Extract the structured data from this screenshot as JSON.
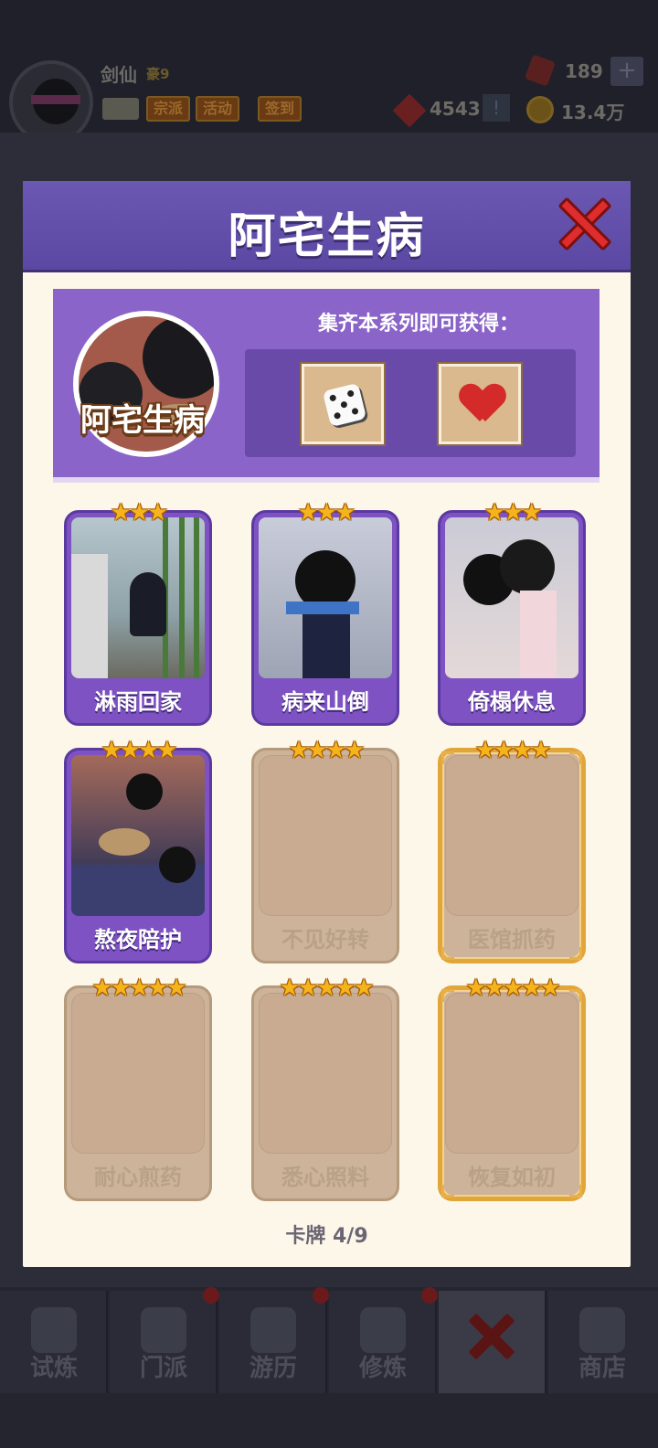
{
  "player": {
    "name": "剑仙",
    "rank": "豪9",
    "gems": "189",
    "tickets": "4543",
    "coins": "13.4万",
    "tags": [
      "宗派",
      "活动",
      "签到"
    ]
  },
  "modal": {
    "title": "阿宅生病",
    "series_name": "阿宅生病",
    "reward_title": "集齐本系列即可获得：",
    "rewards": [
      "dice-icon",
      "heart-icon"
    ],
    "progress_label": "卡牌 4/9",
    "cards": [
      {
        "label": "淋雨回家",
        "stars": "★★★",
        "owned": true
      },
      {
        "label": "病来山倒",
        "stars": "★★★",
        "owned": true
      },
      {
        "label": "倚榻休息",
        "stars": "★★★",
        "owned": true
      },
      {
        "label": "熬夜陪护",
        "stars": "★★★★",
        "owned": true
      },
      {
        "label": "不见好转",
        "stars": "★★★★",
        "owned": false
      },
      {
        "label": "医馆抓药",
        "stars": "★★★★",
        "owned": false
      },
      {
        "label": "耐心煎药",
        "stars": "★★★★★",
        "owned": false
      },
      {
        "label": "悉心照料",
        "stars": "★★★★★",
        "owned": false
      },
      {
        "label": "恢复如初",
        "stars": "★★★★★",
        "owned": false
      }
    ]
  },
  "nav": {
    "items": [
      "试炼",
      "门派",
      "游历",
      "修炼",
      "",
      "商店"
    ]
  },
  "colors": {
    "header": "#5b48a3",
    "owned_card": "#7e52c2",
    "locked_card": "#ccb39a",
    "gold_frame": "#e1a63a",
    "star": "#f6b41c",
    "close": "#e02c2c"
  }
}
